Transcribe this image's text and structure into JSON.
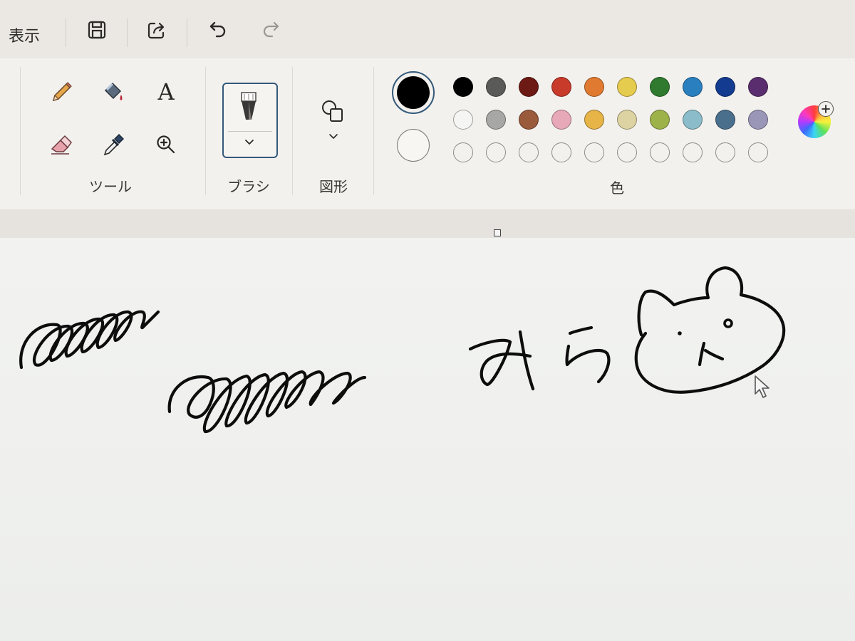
{
  "menu": {
    "view_label": "表示"
  },
  "toolbar_icons": [
    "save-icon",
    "share-icon",
    "undo-icon",
    "redo-icon"
  ],
  "groups": {
    "tools_label": "ツール",
    "brushes_label": "ブラシ",
    "shapes_label": "図形",
    "colors_label": "色"
  },
  "tools": {
    "text_glyph": "A"
  },
  "colors": {
    "primary": "#000000",
    "secondary": "#f7f6f3",
    "palette_row1": [
      "#000000",
      "#5a5a58",
      "#6e1a14",
      "#c83a2a",
      "#e07a30",
      "#e6cc4e",
      "#2f7a2f",
      "#2a7fbe",
      "#133b8f",
      "#5a2e6e"
    ],
    "palette_row2": [
      "#f5f5f3",
      "#a7a7a5",
      "#9a5a3c",
      "#e7a9b8",
      "#e6b447",
      "#ddd3a2",
      "#9db34a",
      "#8bbcc9",
      "#4a6f8d",
      "#9a96b8"
    ],
    "palette_row3_count": 10
  },
  "accent": "#33597a"
}
